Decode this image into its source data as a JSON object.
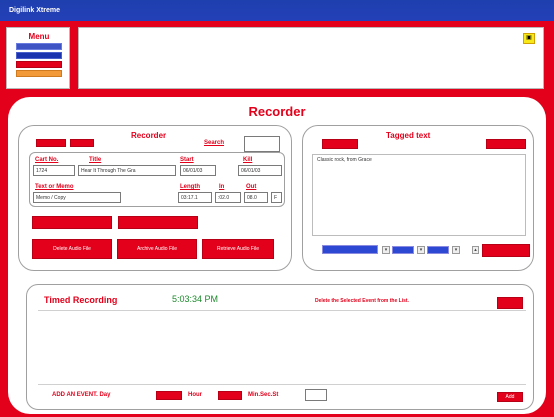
{
  "window": {
    "title": "Digilink Xtreme"
  },
  "menu": {
    "title": "Menu",
    "button_colors": [
      "#3f54c4",
      "#1c33b0",
      "#e3001b",
      "#f29a3a"
    ]
  },
  "note_button": {
    "icon": "note-icon"
  },
  "recorder": {
    "title": "Recorder"
  },
  "recorder_panel": {
    "title": "Recorder",
    "search_label": "Search",
    "search_value": "",
    "cart_no": {
      "label": "Cart No.",
      "value": "1724"
    },
    "title_field": {
      "label": "Title",
      "value": "Hear It Through The Gra"
    },
    "start": {
      "label": "Start",
      "value": "06/01/03"
    },
    "kill": {
      "label": "Kill",
      "value": "06/01/03"
    },
    "text_or_memo": {
      "label": "Text or Memo",
      "value": "Memo / Copy"
    },
    "length": {
      "label": "Length",
      "value": "03:17.1"
    },
    "intro": {
      "label": "In",
      "value": ":02.0"
    },
    "out": {
      "label": "Out",
      "value": "08.0"
    },
    "f_value": "F",
    "buttons": [
      "Delete Audio File",
      "Archive Audio File",
      "Retrieve Audio File"
    ]
  },
  "tagged": {
    "title": "Tagged text",
    "text": "Classic rock, from Grace"
  },
  "timed": {
    "title": "Timed Recording",
    "time": "5:03:34 PM",
    "delete_label": "Delete the Selected Event from the List.",
    "add_label": "ADD AN EVENT. Day",
    "hour_label": "Hour",
    "minsec_label": "Min.Sec.St",
    "add_button": "Add"
  }
}
